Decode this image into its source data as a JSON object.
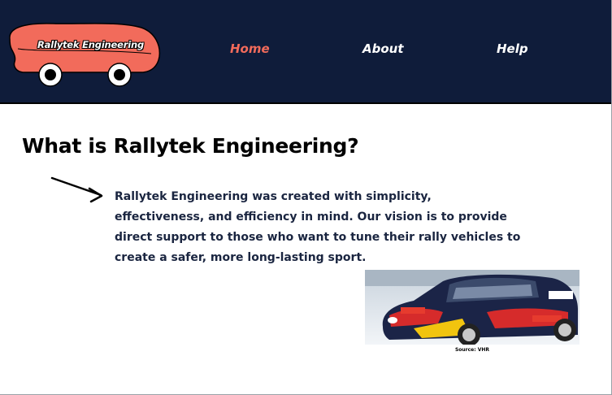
{
  "brand": {
    "name": "Rallytek Engineering",
    "logo_icon": "car-logo-icon",
    "logo_color": "#f26b5b",
    "header_bg": "#0f1c3a"
  },
  "nav": {
    "items": [
      {
        "label": "Home",
        "color": "#f26b5b",
        "active": true
      },
      {
        "label": "About",
        "color": "#ffffff",
        "active": false
      },
      {
        "label": "Help",
        "color": "#ffffff",
        "active": false
      }
    ]
  },
  "main": {
    "title": "What is Rallytek Engineering?",
    "arrow_icon": "arrow-right-icon",
    "intro": "Rallytek Engineering was created with simplicity, effectiveness, and efficiency in mind. Our vision is to provide direct support to those who want to tune their rally vehicles to create a safer, more long-lasting sport.",
    "photo": {
      "description_icon": "rally-car-photo",
      "caption": "Source: VHR"
    }
  }
}
